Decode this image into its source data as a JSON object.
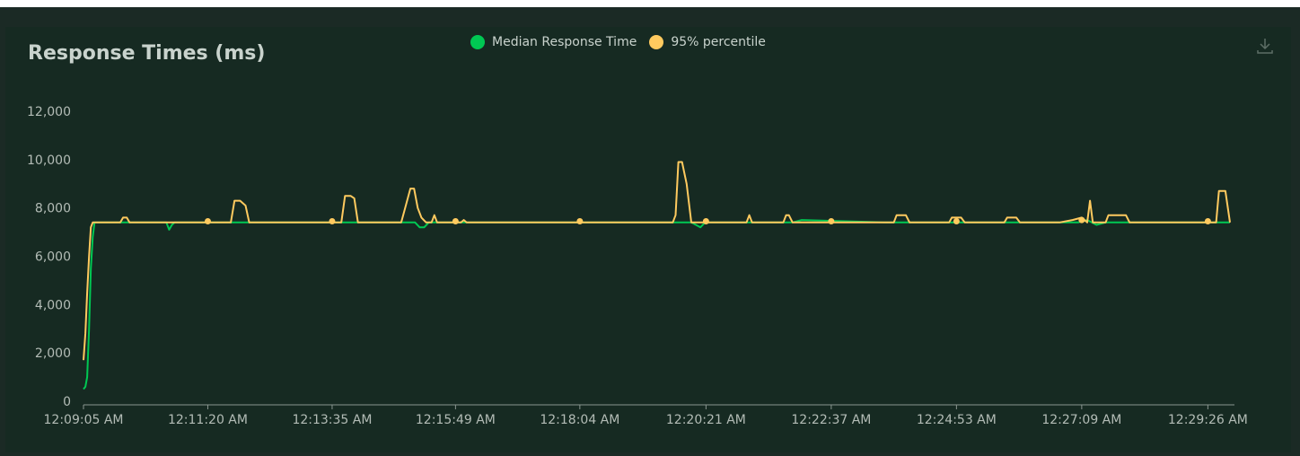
{
  "title": "Response Times (ms)",
  "legend": [
    {
      "name": "Median Response Time",
      "color": "#00c853"
    },
    {
      "name": "95% percentile",
      "color": "#ffca5f"
    }
  ],
  "icons": {
    "download": "download-icon"
  },
  "chart_data": {
    "type": "line",
    "title": "Response Times (ms)",
    "ylim": [
      0,
      12000
    ],
    "yticks": [
      0,
      2000,
      4000,
      6000,
      8000,
      10000,
      12000
    ],
    "ytick_labels": [
      "0",
      "2,000",
      "4,000",
      "6,000",
      "8,000",
      "10,000",
      "12,000"
    ],
    "xlim": [
      0,
      1245
    ],
    "xtick_positions": [
      0,
      135,
      270,
      404,
      539,
      676,
      812,
      948,
      1084,
      1221
    ],
    "xtick_labels": [
      "12:09:05 AM",
      "12:11:20 AM",
      "12:13:35 AM",
      "12:15:49 AM",
      "12:18:04 AM",
      "12:20:21 AM",
      "12:22:37 AM",
      "12:24:53 AM",
      "12:27:09 AM",
      "12:29:26 AM"
    ],
    "grid": false,
    "legend_position": "top-center",
    "series": [
      {
        "name": "Median Response Time",
        "color": "#00c853",
        "x": [
          0,
          2,
          4,
          6,
          8,
          10,
          12,
          14,
          16,
          90,
          93,
          96,
          99,
          160,
          250,
          270,
          300,
          330,
          350,
          360,
          365,
          370,
          375,
          410,
          600,
          660,
          665,
          670,
          675,
          680,
          700,
          770,
          780,
          870,
          940,
          990,
          1060,
          1080,
          1090,
          1100,
          1110,
          1120,
          1130,
          1140,
          1150,
          1200,
          1245
        ],
        "y": [
          500,
          600,
          1000,
          3000,
          5500,
          6800,
          7400,
          7400,
          7400,
          7400,
          7100,
          7300,
          7400,
          7400,
          7400,
          7400,
          7400,
          7400,
          7400,
          7400,
          7200,
          7200,
          7400,
          7400,
          7400,
          7400,
          7300,
          7200,
          7400,
          7400,
          7400,
          7400,
          7500,
          7400,
          7400,
          7400,
          7400,
          7400,
          7500,
          7300,
          7400,
          7400,
          7400,
          7400,
          7400,
          7400,
          7400
        ]
      },
      {
        "name": "95% percentile",
        "color": "#ffca5f",
        "x": [
          0,
          2,
          4,
          6,
          8,
          10,
          12,
          40,
          43,
          47,
          50,
          100,
          135,
          160,
          164,
          170,
          176,
          180,
          220,
          270,
          280,
          284,
          290,
          294,
          298,
          340,
          345,
          350,
          355,
          359,
          363,
          367,
          372,
          378,
          381,
          384,
          390,
          404,
          410,
          413,
          416,
          420,
          539,
          640,
          643,
          646,
          650,
          655,
          660,
          663,
          666,
          676,
          700,
          720,
          723,
          726,
          750,
          760,
          763,
          766,
          770,
          800,
          880,
          883,
          887,
          893,
          897,
          940,
          943,
          947,
          953,
          957,
          1000,
          1003,
          1007,
          1013,
          1017,
          1060,
          1074,
          1084,
          1090,
          1093,
          1096,
          1110,
          1113,
          1117,
          1127,
          1132,
          1136,
          1200,
          1221,
          1230,
          1233,
          1237,
          1240,
          1245
        ],
        "y": [
          1700,
          2800,
          4500,
          6000,
          7200,
          7400,
          7400,
          7400,
          7600,
          7600,
          7400,
          7400,
          7400,
          7400,
          8300,
          8300,
          8100,
          7400,
          7400,
          7400,
          7400,
          8500,
          8500,
          8400,
          7400,
          7400,
          7400,
          8100,
          8800,
          8800,
          8000,
          7600,
          7400,
          7400,
          7700,
          7400,
          7400,
          7400,
          7400,
          7500,
          7400,
          7400,
          7400,
          7400,
          7700,
          9900,
          9900,
          9000,
          7400,
          7400,
          7400,
          7400,
          7400,
          7400,
          7700,
          7400,
          7400,
          7400,
          7700,
          7700,
          7400,
          7400,
          7400,
          7700,
          7700,
          7700,
          7400,
          7400,
          7600,
          7600,
          7600,
          7400,
          7400,
          7600,
          7600,
          7600,
          7400,
          7400,
          7500,
          7600,
          7400,
          8300,
          7400,
          7400,
          7700,
          7700,
          7700,
          7700,
          7400,
          7400,
          7400,
          7400,
          8700,
          8700,
          8700,
          7400
        ]
      }
    ],
    "markers": {
      "series": "95% percentile",
      "x": [
        135,
        270,
        404,
        539,
        676,
        812,
        948,
        1084,
        1221
      ],
      "y": [
        7450,
        7450,
        7450,
        7450,
        7450,
        7450,
        7450,
        7500,
        7450
      ]
    }
  }
}
